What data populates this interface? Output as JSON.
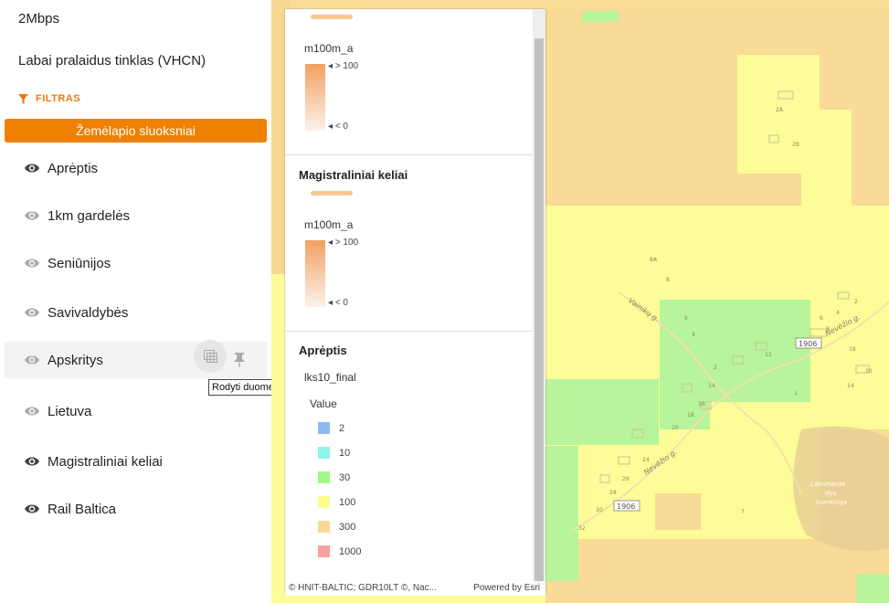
{
  "sidebar": {
    "top_item": "2Mbps",
    "vhcn": "Labai pralaidus tinklas (VHCN)",
    "filter_label": "FILTRAS",
    "layers_title": "Žemėlapio sluoksniai",
    "layers": [
      {
        "label": "Aprėptis",
        "visible": true
      },
      {
        "label": "1km gardelės",
        "visible": false
      },
      {
        "label": "Seniūnijos",
        "visible": false
      },
      {
        "label": "Savivaldybės",
        "visible": false
      },
      {
        "label": "Apskritys",
        "visible": false
      },
      {
        "label": "Lietuva",
        "visible": false
      },
      {
        "label": "Magistraliniai keliai",
        "visible": true
      },
      {
        "label": "Rail Baltica",
        "visible": true
      }
    ],
    "tooltip": "Rodyti duomenis"
  },
  "legend": {
    "sections": [
      {
        "field": "m100m_a",
        "max_label": "> 100",
        "min_label": "< 0"
      },
      {
        "title": "Magistraliniai keliai",
        "field": "m100m_a",
        "max_label": "> 100",
        "min_label": "< 0"
      }
    ],
    "apreptis": {
      "title": "Aprėptis",
      "layer": "lks10_final",
      "value_label": "Value",
      "items": [
        {
          "label": "2",
          "color": "#8fb8f5"
        },
        {
          "label": "10",
          "color": "#8ff3e6"
        },
        {
          "label": "30",
          "color": "#a6f58a"
        },
        {
          "label": "100",
          "color": "#fdfd8f"
        },
        {
          "label": "300",
          "color": "#f9d899"
        },
        {
          "label": "1000",
          "color": "#f6a0a0"
        }
      ]
    }
  },
  "footer": {
    "attribution": "© HNIT-BALTIC; GDR10LT ©, Nac...",
    "powered": "Powered by Esri"
  },
  "map": {
    "labels": [
      "2A",
      "2B",
      "8A",
      "8",
      "6",
      "4",
      "2",
      "1",
      "12",
      "14",
      "16",
      "18",
      "20",
      "24",
      "26",
      "28",
      "30",
      "32",
      "14",
      "18",
      "10",
      "8",
      "4",
      "2",
      "7",
      "6"
    ],
    "road_labels": [
      "Vainikų g.",
      "Nevėžio g.",
      "Nevėžio g."
    ],
    "road_numbers": [
      "1906",
      "1906"
    ],
    "pond": [
      "Labūnavos",
      "dyv.",
      "tvenkinys"
    ]
  }
}
